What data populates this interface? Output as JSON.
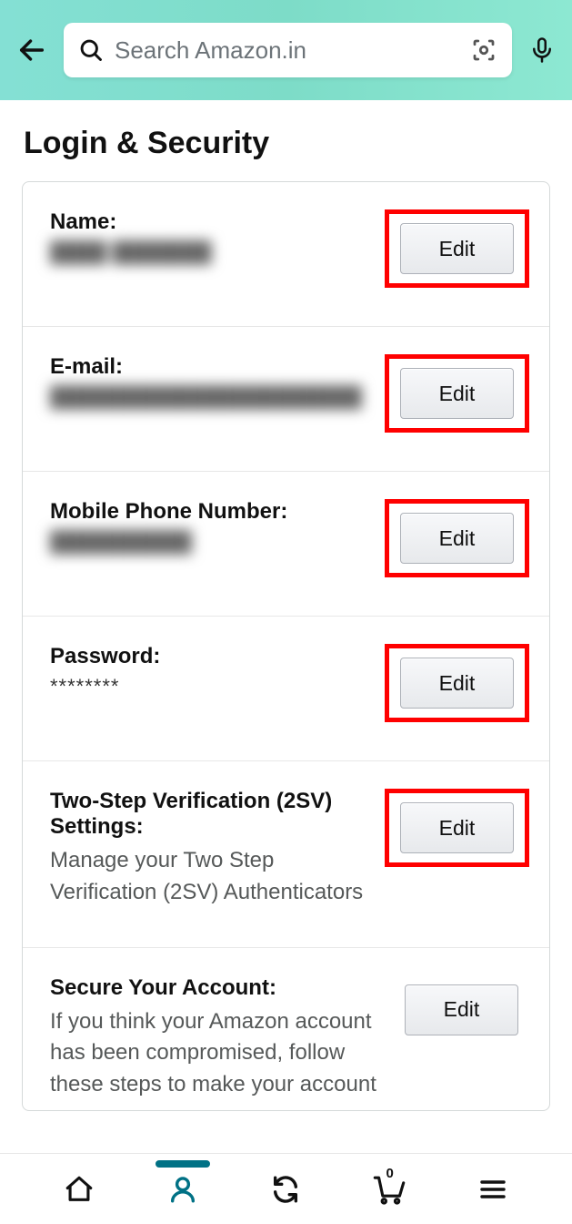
{
  "search": {
    "placeholder": "Search Amazon.in"
  },
  "page": {
    "title": "Login & Security"
  },
  "rows": {
    "name": {
      "label": "Name:",
      "value": "████ ███████",
      "edit": "Edit"
    },
    "email": {
      "label": "E-mail:",
      "value": "██████████████████████",
      "edit": "Edit"
    },
    "phone": {
      "label": "Mobile Phone Number:",
      "value": "██████████",
      "edit": "Edit"
    },
    "password": {
      "label": "Password:",
      "value": "********",
      "edit": "Edit"
    },
    "twostep": {
      "label": "Two-Step Verification (2SV) Settings:",
      "desc": "Manage your Two Step Verification (2SV) Authenticators",
      "edit": "Edit"
    },
    "secure": {
      "label": "Secure Your Account:",
      "desc": "If you think your Amazon account has been compromised, follow these steps to make your account",
      "edit": "Edit"
    }
  },
  "nav": {
    "cart_count": "0"
  }
}
